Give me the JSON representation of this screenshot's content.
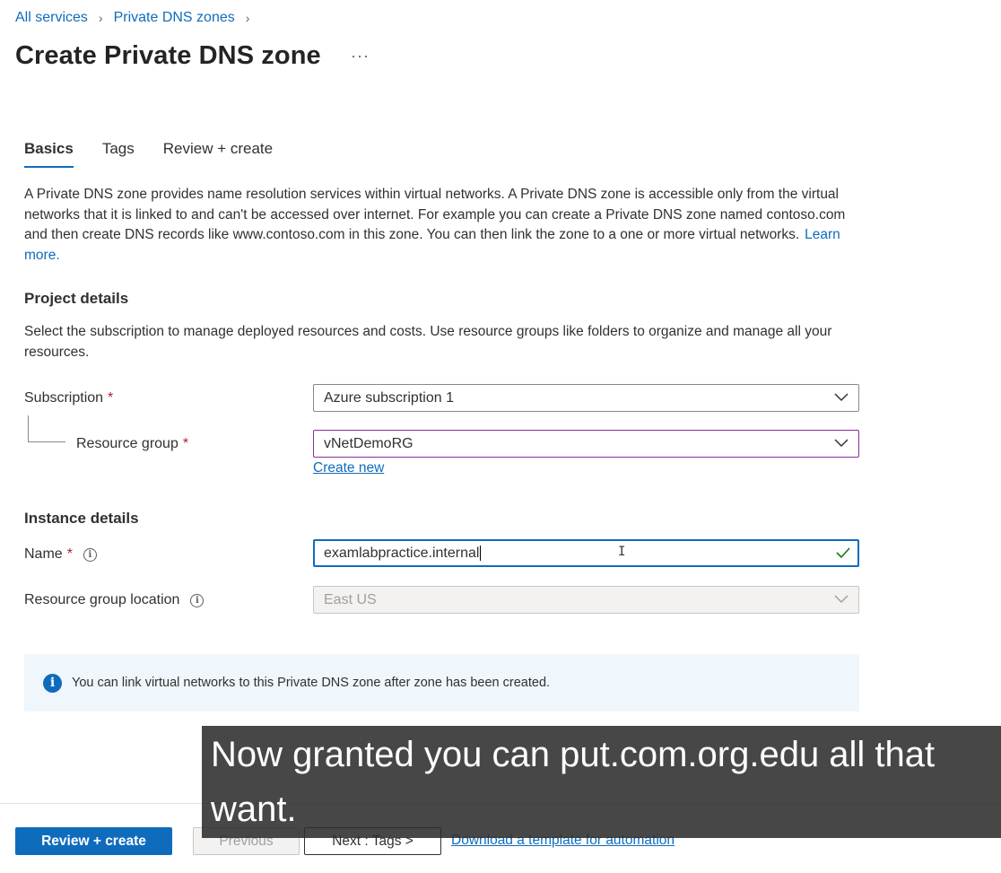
{
  "breadcrumb": {
    "items": [
      "All services",
      "Private DNS zones"
    ]
  },
  "page": {
    "title": "Create Private DNS zone",
    "more": "···"
  },
  "tabs": [
    {
      "label": "Basics",
      "active": true
    },
    {
      "label": "Tags",
      "active": false
    },
    {
      "label": "Review + create",
      "active": false
    }
  ],
  "description": {
    "text": "A Private DNS zone provides name resolution services within virtual networks. A Private DNS zone is accessible only from the virtual networks that it is linked to and can't be accessed over internet. For example you can create a Private DNS zone named contoso.com and then create DNS records like www.contoso.com in this zone. You can then link the zone to a one or more virtual networks.",
    "link": "Learn more."
  },
  "project": {
    "title": "Project details",
    "desc": "Select the subscription to manage deployed resources and costs. Use resource groups like folders to organize and manage all your resources.",
    "subscription_label": "Subscription",
    "subscription_value": "Azure subscription 1",
    "resource_group_label": "Resource group",
    "resource_group_value": "vNetDemoRG",
    "create_new": "Create new",
    "required_mark": "*"
  },
  "instance": {
    "title": "Instance details",
    "name_label": "Name",
    "name_value": "examlabpractice.internal",
    "location_label": "Resource group location",
    "location_value": "East US"
  },
  "banner": {
    "text": "You can link virtual networks to this Private DNS zone after zone has been created."
  },
  "footer": {
    "review_create": "Review + create",
    "previous": "Previous",
    "next": "Next : Tags >",
    "download_link": "Download a template for automation"
  },
  "caption": {
    "text": "Now granted you can put.com.org.edu all that want."
  },
  "colors": {
    "accent": "#0f6cbd",
    "required": "#a4262c",
    "valid": "#107c10",
    "banner_bg": "#eff6fc"
  },
  "icons": {
    "chevron": "chevron-down-icon",
    "info": "info-icon",
    "check": "checkmark-icon",
    "more": "more-icon"
  }
}
